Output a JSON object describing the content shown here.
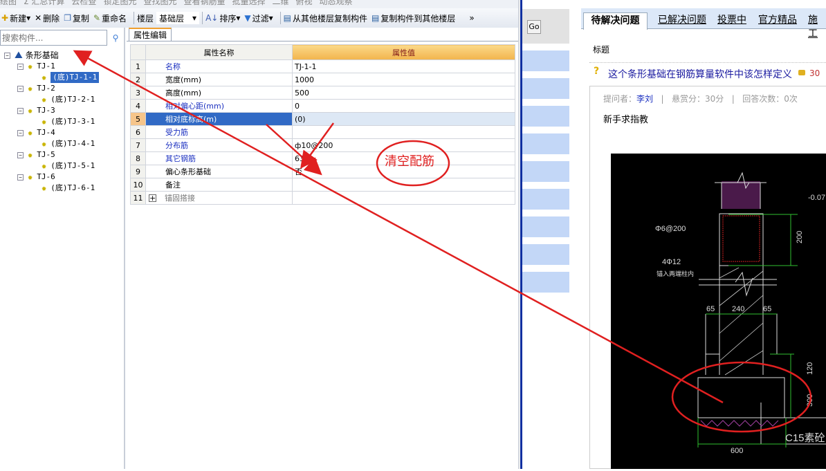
{
  "toolbar_top": {
    "items": [
      "绘图",
      "Σ 汇总计算",
      "云检查",
      "锁定图元",
      "查找图元",
      "查看钢筋量",
      "批量选择",
      "二维",
      "俯视",
      "动态观察"
    ]
  },
  "toolbar": {
    "new": "新建",
    "delete": "删除",
    "copy": "复制",
    "rename": "重命名",
    "floor_label": "楼层",
    "floor_value": "基础层",
    "sort": "排序",
    "filter": "过滤",
    "copy_from": "从其他楼层复制构件",
    "copy_to": "复制构件到其他楼层",
    "more": "»"
  },
  "search": {
    "placeholder": "搜索构件..."
  },
  "tree": {
    "root": "条形基础",
    "groups": [
      {
        "name": "TJ-1",
        "child": "(底)TJ-1-1"
      },
      {
        "name": "TJ-2",
        "child": "(底)TJ-2-1"
      },
      {
        "name": "TJ-3",
        "child": "(底)TJ-3-1"
      },
      {
        "name": "TJ-4",
        "child": "(底)TJ-4-1"
      },
      {
        "name": "TJ-5",
        "child": "(底)TJ-5-1"
      },
      {
        "name": "TJ-6",
        "child": "(底)TJ-6-1"
      }
    ],
    "selected": "(底)TJ-1-1"
  },
  "props": {
    "tab": "属性编辑",
    "col_name": "属性名称",
    "col_value": "属性值",
    "rows": [
      {
        "n": "1",
        "name": "名称",
        "value": "TJ-1-1",
        "blue": true
      },
      {
        "n": "2",
        "name": "宽度(mm)",
        "value": "1000",
        "blue": false
      },
      {
        "n": "3",
        "name": "高度(mm)",
        "value": "500",
        "blue": false
      },
      {
        "n": "4",
        "name": "相对偏心距(mm)",
        "value": "0",
        "blue": true
      },
      {
        "n": "5",
        "name": "相对底标高(m)",
        "value": "(0)",
        "blue": true,
        "selected": true
      },
      {
        "n": "6",
        "name": "受力筋",
        "value": "",
        "blue": true
      },
      {
        "n": "7",
        "name": "分布筋",
        "value": "ф10@200",
        "blue": true
      },
      {
        "n": "8",
        "name": "其它钢筋",
        "value": "63",
        "blue": true
      },
      {
        "n": "9",
        "name": "偏心条形基础",
        "value": "否",
        "blue": false
      },
      {
        "n": "10",
        "name": "备注",
        "value": "",
        "blue": false
      },
      {
        "n": "11",
        "name": "锚固搭接",
        "value": "",
        "grey": true,
        "expandable": true
      }
    ]
  },
  "annotation": {
    "text": "清空配筋",
    "color": "#e02020"
  },
  "browser": {
    "go": "Go",
    "tabs": [
      "待解决问题",
      "已解决问题",
      "投票中",
      "官方精品",
      "施工"
    ],
    "title_label": "标题",
    "question": "这个条形基础在钢筋算量软件中该怎样定义",
    "score": "30",
    "meta": {
      "asker_label": "提问者：",
      "asker": "李刘",
      "reward": "悬赏分：30分",
      "answers": "回答次数：0次"
    },
    "description": "新手求指教"
  },
  "drawing": {
    "labels": [
      "Φ6@200",
      "4Φ12",
      "锚入两端柱内",
      "-0.07",
      "200",
      "65",
      "240",
      "65",
      "120",
      "300",
      "600",
      "C15素砼"
    ]
  }
}
